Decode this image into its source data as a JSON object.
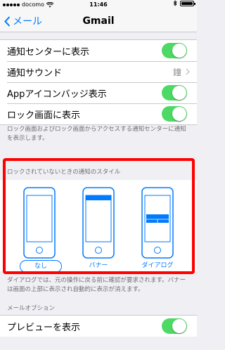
{
  "status_bar": {
    "carrier": "docomo",
    "time": "11:46"
  },
  "nav": {
    "back_label": "メール",
    "title": "Gmail"
  },
  "settings_group": {
    "rows": [
      {
        "label": "通知センターに表示",
        "toggle": true
      },
      {
        "label": "通知サウンド",
        "value": "鐘"
      },
      {
        "label": "Appアイコンバッジ表示",
        "toggle": true
      },
      {
        "label": "ロック画面に表示",
        "toggle": true
      }
    ]
  },
  "lock_screen_footnote": "ロック画面およびロック画面からアクセスする通知センターに通知を表示します。",
  "alert_style": {
    "header": "ロックされていないときの通知のスタイル",
    "options": [
      {
        "label": "なし",
        "selected": true
      },
      {
        "label": "バナー",
        "selected": false
      },
      {
        "label": "ダイアログ",
        "selected": false
      }
    ],
    "footnote": "ダイアログでは、元の操作に戻る前に確認が要求されます。バナーは画面の上部に表示され自動的に表示が消えます。"
  },
  "mail_options": {
    "header": "メールオプション",
    "rows": [
      {
        "label": "プレビューを表示",
        "toggle": true
      }
    ]
  },
  "colors": {
    "accent": "#007aff",
    "toggle_on": "#4cd964",
    "highlight": "#ff0000"
  }
}
